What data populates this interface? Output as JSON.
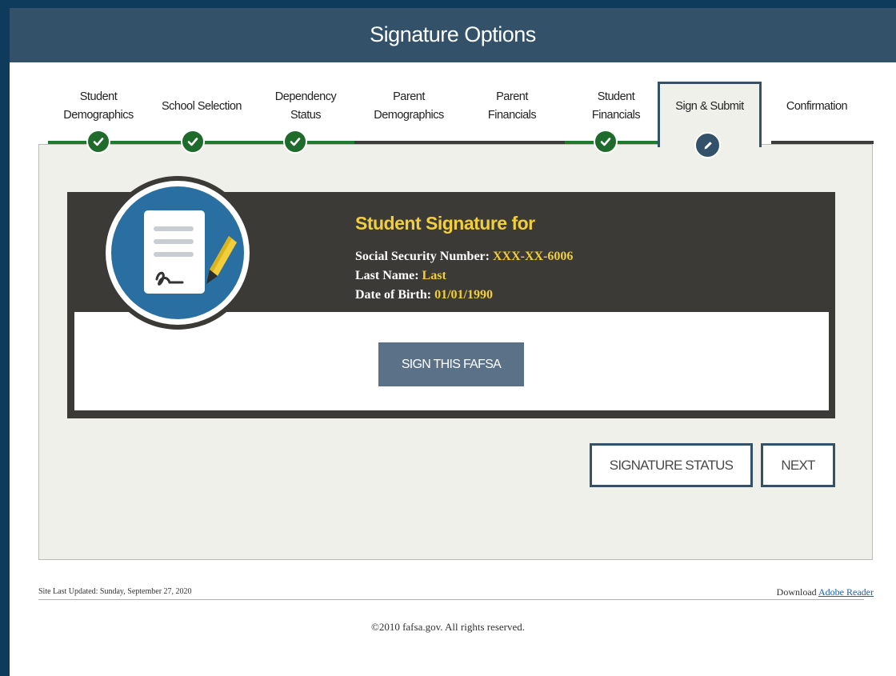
{
  "header": {
    "title": "Signature Options"
  },
  "steps": [
    {
      "label_1": "Student",
      "label_2": "Demographics",
      "status": "complete"
    },
    {
      "label_1": "School Selection",
      "status": "complete"
    },
    {
      "label_1": "Dependency",
      "label_2": "Status",
      "status": "complete"
    },
    {
      "label_1": "Parent",
      "label_2": "Demographics",
      "status": "incomplete"
    },
    {
      "label_1": "Parent",
      "label_2": "Financials",
      "status": "incomplete"
    },
    {
      "label_1": "Student",
      "label_2": "Financials",
      "status": "complete"
    },
    {
      "label_1": "Sign & Submit",
      "status": "current",
      "icon": "pencil-icon"
    },
    {
      "label_1": "Confirmation",
      "status": "upcoming"
    }
  ],
  "signature_card": {
    "title": "Student Signature for",
    "ssn_label": "Social Security Number:",
    "ssn_value": "XXX-XX-6006",
    "last_name_label": "Last Name:",
    "last_name_value": "Last",
    "dob_label": "Date of Birth:",
    "dob_value": "01/01/1990",
    "icon": "signed-document-icon",
    "sign_button": "SIGN THIS FAFSA"
  },
  "actions": {
    "signature_status": "SIGNATURE STATUS",
    "next": "NEXT"
  },
  "footer": {
    "updated": "Site Last Updated: Sunday, September 27, 2020",
    "download_text": "Download",
    "download_link": "Adobe Reader",
    "copyright": "©2010 fafsa.gov. All rights reserved."
  },
  "colors": {
    "header": "#33526a",
    "complete_green": "#1e7a2e",
    "card_bg": "#3b3a36",
    "highlight_yellow": "#f2cf3a",
    "button_fill": "#5a7187"
  }
}
